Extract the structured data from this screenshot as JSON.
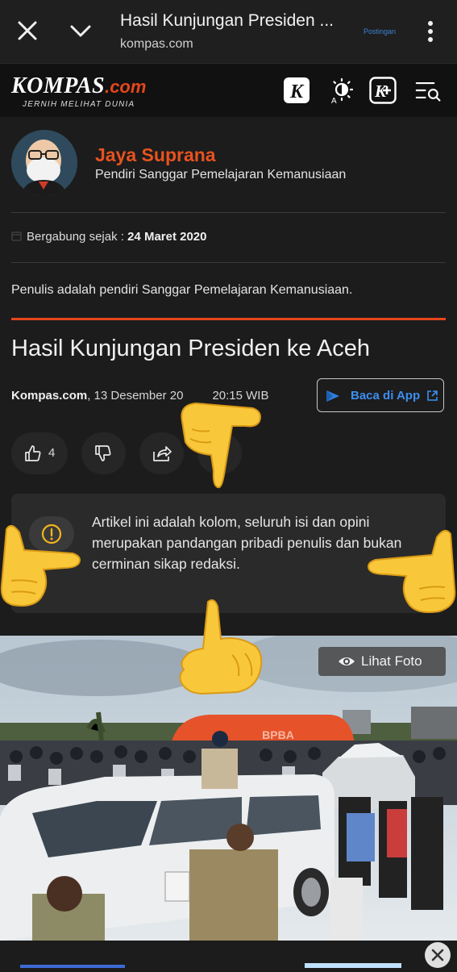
{
  "browser": {
    "title": "Hasil Kunjungan Presiden ...",
    "domain": "kompas.com",
    "postingan": "Postingan"
  },
  "site": {
    "logo_main": "KOMPAS",
    "logo_suffix": ".com",
    "tagline": "JERNIH MELIHAT DUNIA",
    "icons": [
      "k-icon",
      "brightness-icon",
      "kplus-icon",
      "menu-search-icon"
    ]
  },
  "author": {
    "name": "Jaya Suprana",
    "role": "Pendiri Sanggar Pemelajaran Kemanusiaan",
    "joined_label": "Bergabung sejak : ",
    "joined_date": "24 Maret 2020",
    "bio": "Penulis adalah pendiri Sanggar Pemelajaran Kemanusiaan."
  },
  "article": {
    "title": "Hasil Kunjungan Presiden ke Aceh",
    "source": "Kompas.com",
    "date": ", 13 Desember 20",
    "time": "20:15 WIB",
    "app_button": "Baca di App",
    "likes": "4",
    "notice": "Artikel ini adalah kolom, seluruh isi dan opini merupakan pandangan pribadi penulis dan bukan cerminan sikap redaksi.",
    "photo_button": "Lihat Foto",
    "tent_text": "BPBA"
  },
  "colors": {
    "accent": "#e5461c",
    "link": "#3d8ef0",
    "background": "#1c1c1c"
  }
}
